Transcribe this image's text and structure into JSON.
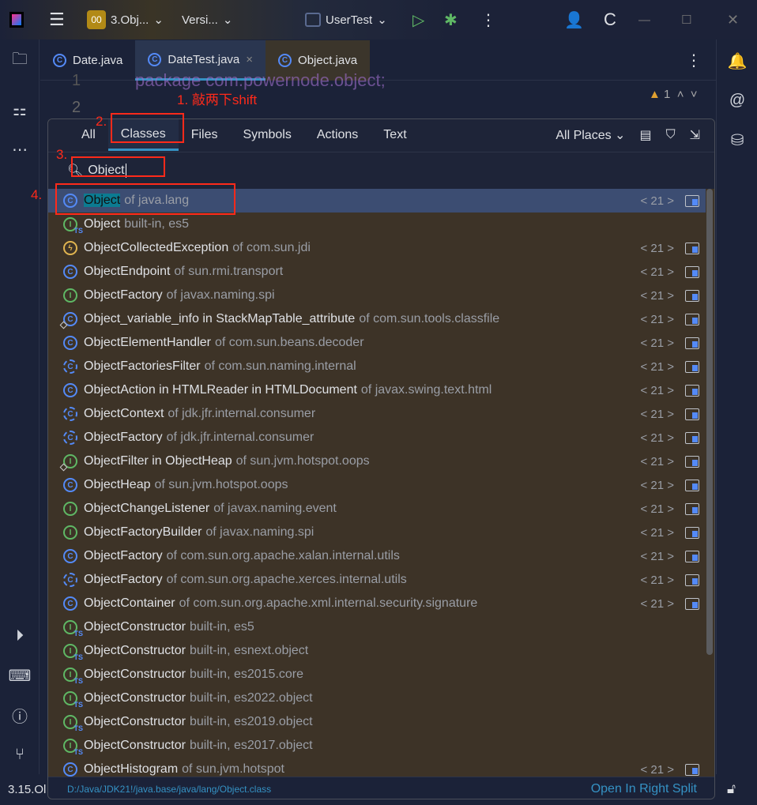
{
  "titlebar": {
    "project_badge": "00",
    "project": "3.Obj...",
    "vcs": "Versi...",
    "run_config": "UserTest"
  },
  "tabs": [
    {
      "label": "Date.java"
    },
    {
      "label": "DateTest.java",
      "close": "×"
    },
    {
      "label": "Object.java"
    }
  ],
  "editor": {
    "line1": "1",
    "line2": "2",
    "code_line": "package com.powernode.object;",
    "warnings": "1"
  },
  "annotations": {
    "a1": "1. 敲两下shift",
    "a2": "2.",
    "a3": "3.",
    "a4": "4."
  },
  "popup": {
    "tabs": [
      "All",
      "Classes",
      "Files",
      "Symbols",
      "Actions",
      "Text"
    ],
    "selected_tab": "Classes",
    "scope": "All Places",
    "search_value": "Object",
    "results": [
      {
        "icon": "class",
        "name": "Object",
        "loc": "of java.lang",
        "nav": "< 21 >"
      },
      {
        "icon": "ts",
        "name": "Object",
        "loc": "built-in, es5"
      },
      {
        "icon": "exception",
        "name": "ObjectCollectedException",
        "loc": "of com.sun.jdi",
        "nav": "< 21 >"
      },
      {
        "icon": "class",
        "name": "ObjectEndpoint",
        "loc": "of sun.rmi.transport",
        "nav": "< 21 >"
      },
      {
        "icon": "interface",
        "name": "ObjectFactory",
        "loc": "of javax.naming.spi",
        "nav": "< 21 >"
      },
      {
        "icon": "class-private",
        "name": "Object_variable_info in StackMapTable_attribute",
        "loc": "of com.sun.tools.classfile",
        "nav": "< 21 >"
      },
      {
        "icon": "class",
        "name": "ObjectElementHandler",
        "loc": "of com.sun.beans.decoder",
        "nav": "< 21 >"
      },
      {
        "icon": "abstract",
        "name": "ObjectFactoriesFilter",
        "loc": "of com.sun.naming.internal",
        "nav": "< 21 >"
      },
      {
        "icon": "class",
        "name": "ObjectAction in HTMLReader in HTMLDocument",
        "loc": "of javax.swing.text.html",
        "nav": "< 21 >"
      },
      {
        "icon": "abstract",
        "name": "ObjectContext",
        "loc": "of jdk.jfr.internal.consumer",
        "nav": "< 21 >"
      },
      {
        "icon": "abstract",
        "name": "ObjectFactory",
        "loc": "of jdk.jfr.internal.consumer",
        "nav": "< 21 >"
      },
      {
        "icon": "interface-private",
        "name": "ObjectFilter in ObjectHeap",
        "loc": "of sun.jvm.hotspot.oops",
        "nav": "< 21 >"
      },
      {
        "icon": "class",
        "name": "ObjectHeap",
        "loc": "of sun.jvm.hotspot.oops",
        "nav": "< 21 >"
      },
      {
        "icon": "interface",
        "name": "ObjectChangeListener",
        "loc": "of javax.naming.event",
        "nav": "< 21 >"
      },
      {
        "icon": "interface",
        "name": "ObjectFactoryBuilder",
        "loc": "of javax.naming.spi",
        "nav": "< 21 >"
      },
      {
        "icon": "class",
        "name": "ObjectFactory",
        "loc": "of com.sun.org.apache.xalan.internal.utils",
        "nav": "< 21 >"
      },
      {
        "icon": "abstract",
        "name": "ObjectFactory",
        "loc": "of com.sun.org.apache.xerces.internal.utils",
        "nav": "< 21 >"
      },
      {
        "icon": "class",
        "name": "ObjectContainer",
        "loc": "of com.sun.org.apache.xml.internal.security.signature",
        "nav": "< 21 >"
      },
      {
        "icon": "ts",
        "name": "ObjectConstructor",
        "loc": "built-in, es5"
      },
      {
        "icon": "ts",
        "name": "ObjectConstructor",
        "loc": "built-in, esnext.object"
      },
      {
        "icon": "ts",
        "name": "ObjectConstructor",
        "loc": "built-in, es2015.core"
      },
      {
        "icon": "ts",
        "name": "ObjectConstructor",
        "loc": "built-in, es2022.object"
      },
      {
        "icon": "ts",
        "name": "ObjectConstructor",
        "loc": "built-in, es2019.object"
      },
      {
        "icon": "ts",
        "name": "ObjectConstructor",
        "loc": "built-in, es2017.object"
      },
      {
        "icon": "class-runnable",
        "name": "ObjectHistogram",
        "loc": "of sun.jvm.hotspot",
        "nav": "< 21 >"
      }
    ],
    "footer_path": "D:/Java/JDK21!/java.base/java/lang/Object.class",
    "open_split": "Open In Right Split"
  },
  "status": {
    "left": "3.15.Ol"
  },
  "colors": {
    "accent": "#3592c4",
    "annotation": "#ff2a1a",
    "list_bg": "#3d3327",
    "selected": "#3c4d72"
  }
}
